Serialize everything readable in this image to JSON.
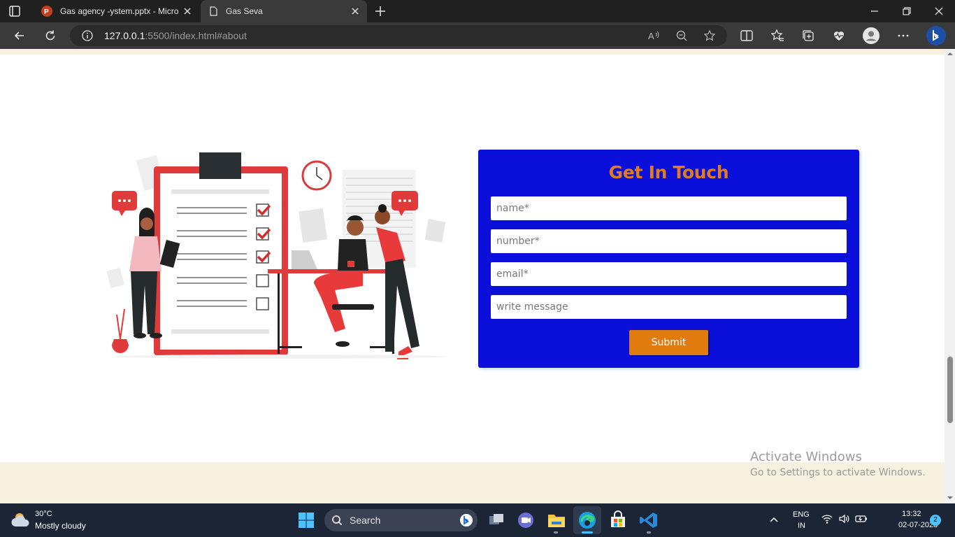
{
  "browser": {
    "tabs": [
      {
        "title": "Gas agency -ystem.pptx - Micros",
        "icon": "powerpoint-icon",
        "active": false
      },
      {
        "title": "Gas Seva",
        "icon": "page-icon",
        "active": true
      }
    ],
    "address": {
      "host": "127.0.0.1",
      "path": ":5500/index.html#about"
    }
  },
  "contact": {
    "title": "Get In Touch",
    "name_placeholder": "name*",
    "number_placeholder": "number*",
    "email_placeholder": "email*",
    "message_placeholder": "write message",
    "submit_label": "Submit",
    "colors": {
      "card": "#0a10d9",
      "title": "#e07b1f",
      "button": "#e07b0d"
    }
  },
  "watermark": {
    "line1": "Activate Windows",
    "line2": "Go to Settings to activate Windows."
  },
  "taskbar": {
    "weather_temp": "30°C",
    "weather_desc": "Mostly cloudy",
    "search_label": "Search",
    "lang_line1": "ENG",
    "lang_line2": "IN",
    "time": "13:32",
    "date": "02-07-2023",
    "notifications": "2"
  }
}
